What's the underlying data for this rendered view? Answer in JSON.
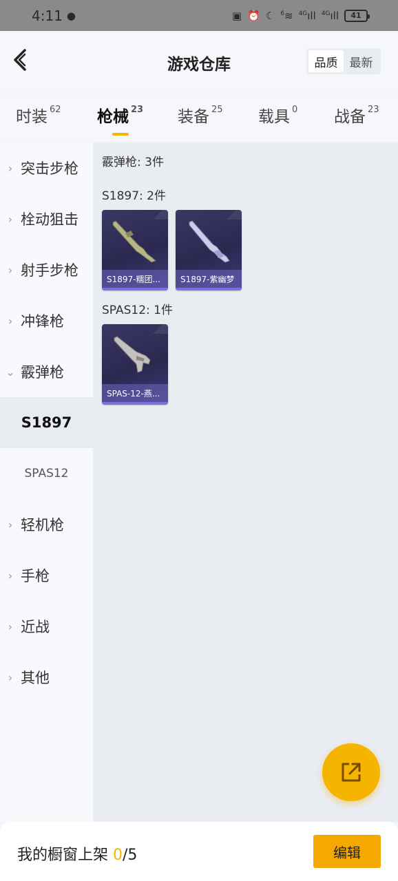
{
  "status_bar": {
    "time": "4:11",
    "battery": "41",
    "network1": "4G",
    "network2": "4G",
    "wifi_tag": "6"
  },
  "header": {
    "title": "游戏仓库",
    "sort_quality": "品质",
    "sort_newest": "最新"
  },
  "tabs": [
    {
      "label": "时装",
      "count": "62"
    },
    {
      "label": "枪械",
      "count": "23"
    },
    {
      "label": "装备",
      "count": "25"
    },
    {
      "label": "载具",
      "count": "0"
    },
    {
      "label": "战备",
      "count": "23"
    }
  ],
  "sidebar": {
    "items": [
      {
        "label": "突击步枪"
      },
      {
        "label": "栓动狙击"
      },
      {
        "label": "射手步枪"
      },
      {
        "label": "冲锋枪"
      },
      {
        "label": "霰弹枪"
      },
      {
        "label": "S1897"
      },
      {
        "label": "SPAS12"
      },
      {
        "label": "轻机枪"
      },
      {
        "label": "手枪"
      },
      {
        "label": "近战"
      },
      {
        "label": "其他"
      }
    ]
  },
  "content": {
    "category_title": "霰弹枪: 3件",
    "groups": [
      {
        "title": "S1897: 2件",
        "items": [
          {
            "name": "S1897-糯团..."
          },
          {
            "name": "S1897-紫幽梦"
          }
        ]
      },
      {
        "title": "SPAS12: 1件",
        "items": [
          {
            "name": "SPAS-12-燕..."
          }
        ]
      }
    ]
  },
  "bottom": {
    "label": "我的橱窗上架 ",
    "count": "0",
    "total": "/5",
    "edit": "编辑"
  },
  "colors": {
    "accent": "#f5b400",
    "card_bg": "#2b2850"
  }
}
